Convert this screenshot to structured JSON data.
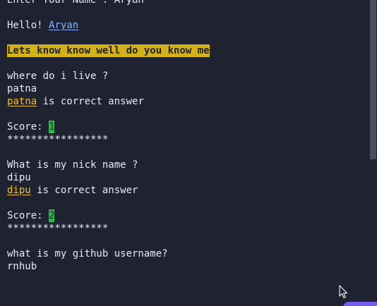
{
  "console": {
    "lines": {
      "prompt_name": "Enter Your Name : Aryan",
      "greeting_prefix": "Hello! ",
      "greeting_name": "Aryan",
      "heading": "Lets know know well do you know me",
      "q1": "where do i live ?",
      "a1_input": "patna",
      "a1_word": "patna",
      "a1_suffix": " is correct answer",
      "score1_label": "Score: ",
      "score1_value": "1",
      "sep1": "*****************",
      "q2": "What is my nick name ?",
      "a2_input": "dipu",
      "a2_word": "dipu",
      "a2_suffix": " is correct answer",
      "score2_label": "Score: ",
      "score2_value": "2",
      "sep2": "*****************",
      "q3": "what is my github username?",
      "a3_input": "rnhub"
    }
  },
  "colors": {
    "background": "#1f2331",
    "text": "#e8eaf0",
    "link": "#86b4ff",
    "heading_bg": "#d3b11a",
    "answer": "#f0c12f",
    "score_bg": "#2eb84b",
    "scrollbar": "#4a4f5c"
  },
  "icons": {
    "cursor": "mouse-pointer-icon"
  }
}
